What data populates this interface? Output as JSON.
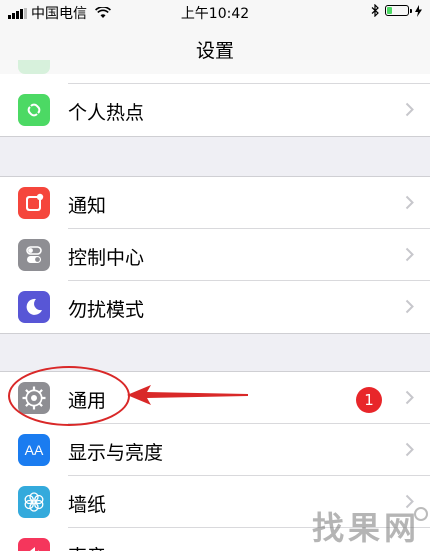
{
  "status_bar": {
    "carrier": "中国电信",
    "time": "上午10:42",
    "battery_level": 0.25,
    "icons": [
      "signal-icon",
      "wifi-icon",
      "bluetooth-icon",
      "battery-icon",
      "charging-icon"
    ]
  },
  "nav": {
    "title": "设置"
  },
  "rows": [
    {
      "label": "个人热点",
      "icon": "hotspot-icon",
      "color": "#4cd964"
    },
    {
      "label": "通知",
      "icon": "notification-icon",
      "color": "#f5463c"
    },
    {
      "label": "控制中心",
      "icon": "control-center-icon",
      "color": "#8e8e93"
    },
    {
      "label": "勿扰模式",
      "icon": "moon-icon",
      "color": "#5856d6"
    },
    {
      "label": "通用",
      "icon": "gear-icon",
      "color": "#8e8e93",
      "badge": "1"
    },
    {
      "label": "显示与亮度",
      "icon": "display-icon",
      "color": "#1a7cf0",
      "icon_text": "AA"
    },
    {
      "label": "墙纸",
      "icon": "wallpaper-icon",
      "color": "#34aadc"
    },
    {
      "label": "声音",
      "icon": "sound-icon",
      "color": "#f5365c"
    }
  ],
  "annotation": {
    "color": "#d92828"
  },
  "watermark": "找果网"
}
